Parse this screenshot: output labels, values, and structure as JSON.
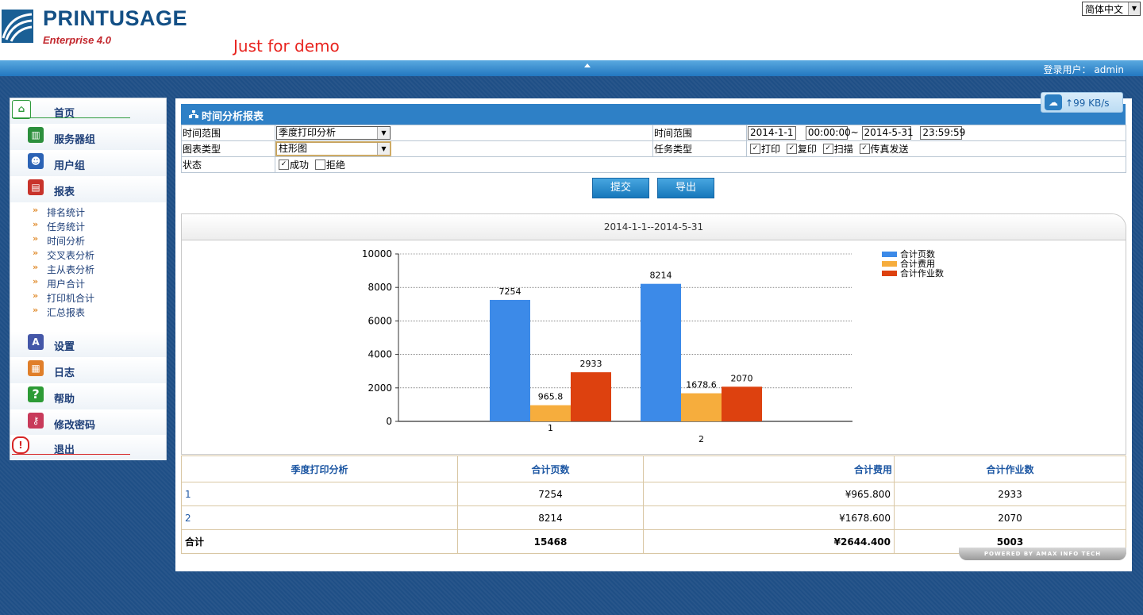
{
  "header": {
    "logo_title": "PRINTUSAGE",
    "logo_subtitle": "Enterprise 4.0",
    "demo_text": "Just for demo",
    "language": "简体中文",
    "login_label": "登录用户：",
    "login_user": "admin"
  },
  "sidebar": {
    "items": [
      {
        "label": "首页",
        "icon": "home-icon",
        "color": "#2e9a3b"
      },
      {
        "label": "服务器组",
        "icon": "server-icon",
        "color": "#2c8f3c"
      },
      {
        "label": "用户组",
        "icon": "users-icon",
        "color": "#2c63b5"
      },
      {
        "label": "报表",
        "icon": "report-icon",
        "color": "#c8332b"
      },
      {
        "label": "设置",
        "icon": "settings-icon",
        "color": "#4457a8"
      },
      {
        "label": "日志",
        "icon": "log-icon",
        "color": "#e07f2a"
      },
      {
        "label": "帮助",
        "icon": "help-icon",
        "color": "#2d9b35"
      },
      {
        "label": "修改密码",
        "icon": "key-icon",
        "color": "#c83a5a"
      },
      {
        "label": "退出",
        "icon": "power-icon",
        "color": "#d62424"
      }
    ],
    "report_sub": [
      "排名统计",
      "任务统计",
      "时间分析",
      "交叉表分析",
      "主从表分析",
      "用户合计",
      "打印机合计",
      "汇总报表"
    ]
  },
  "speed": "99 KB/s",
  "panel": {
    "title": "时间分析报表",
    "time_range_label": "时间范围",
    "time_range_value": "季度打印分析",
    "time_range_label2": "时间范围",
    "start_date": "2014-1-1",
    "start_time": "00:00:00",
    "tilde": "~",
    "end_date": "2014-5-31",
    "end_time": "23:59:59",
    "chart_type_label": "图表类型",
    "chart_type_value": "柱形图",
    "task_type_label": "任务类型",
    "task_types": [
      "打印",
      "复印",
      "扫描",
      "传真发送"
    ],
    "status_label": "状态",
    "status_options": [
      {
        "label": "成功",
        "checked": true
      },
      {
        "label": "拒绝",
        "checked": false
      }
    ],
    "submit": "提交",
    "export": "导出"
  },
  "chart_data": {
    "type": "bar",
    "title": "2014-1-1--2014-5-31",
    "categories": [
      "1",
      "2"
    ],
    "series": [
      {
        "name": "合计页数",
        "values": [
          7254,
          8214
        ],
        "color": "#3c8ae8"
      },
      {
        "name": "合计费用",
        "values": [
          965.8,
          1678.6
        ],
        "color": "#f6ad3d"
      },
      {
        "name": "合计作业数",
        "values": [
          2933,
          2070
        ],
        "color": "#dd410f"
      }
    ],
    "ylim": [
      0,
      10000
    ],
    "yticks": [
      0,
      2000,
      4000,
      6000,
      8000,
      10000
    ],
    "grid": true,
    "legend": "top-right"
  },
  "table": {
    "headers": [
      "季度打印分析",
      "合计页数",
      "合计费用",
      "合计作业数"
    ],
    "rows": [
      [
        "1",
        "7254",
        "¥965.800",
        "2933"
      ],
      [
        "2",
        "8214",
        "¥1678.600",
        "2070"
      ]
    ],
    "total": [
      "合计",
      "15468",
      "¥2644.400",
      "5003"
    ]
  },
  "footer": {
    "powered": "POWERED BY AMAX INFO TECH"
  }
}
